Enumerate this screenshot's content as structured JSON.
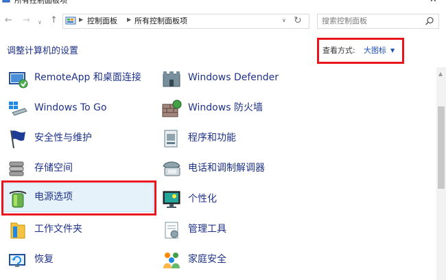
{
  "window": {
    "title": "所有控制面板项",
    "close_glyph": "✕"
  },
  "nav": {
    "back_glyph": "←",
    "forward_glyph": "→",
    "history_glyph": "∨",
    "up_glyph": "↑",
    "breadcrumbs": [
      "控制面板",
      "所有控制面板项"
    ],
    "dropdown_glyph": "∨",
    "refresh_glyph": "↻",
    "search_placeholder": "搜索控制面板"
  },
  "header": {
    "title": "调整计算机的设置",
    "view_label": "查看方式:",
    "view_value": "大图标",
    "view_caret": "▼"
  },
  "items_left": [
    {
      "label": "RemoteApp 和桌面连接",
      "icon": "remoteapp-icon"
    },
    {
      "label": "Windows To Go",
      "icon": "usb-drive-icon"
    },
    {
      "label": "安全性与维护",
      "icon": "flag-icon"
    },
    {
      "label": "存储空间",
      "icon": "storage-icon"
    },
    {
      "label": "电源选项",
      "icon": "battery-icon",
      "highlighted": true
    },
    {
      "label": "工作文件夹",
      "icon": "folder-icon"
    },
    {
      "label": "恢复",
      "icon": "recovery-icon"
    }
  ],
  "items_right": [
    {
      "label": "Windows Defender",
      "icon": "castle-icon"
    },
    {
      "label": "Windows 防火墙",
      "icon": "firewall-icon"
    },
    {
      "label": "程序和功能",
      "icon": "programs-icon"
    },
    {
      "label": "电话和调制解调器",
      "icon": "phone-icon"
    },
    {
      "label": "个性化",
      "icon": "monitor-icon"
    },
    {
      "label": "管理工具",
      "icon": "tools-icon"
    },
    {
      "label": "家庭安全",
      "icon": "family-icon"
    }
  ],
  "colors": {
    "highlight_box": "#e8151c",
    "link": "#1e3287",
    "selection": "#e6f2fa"
  }
}
